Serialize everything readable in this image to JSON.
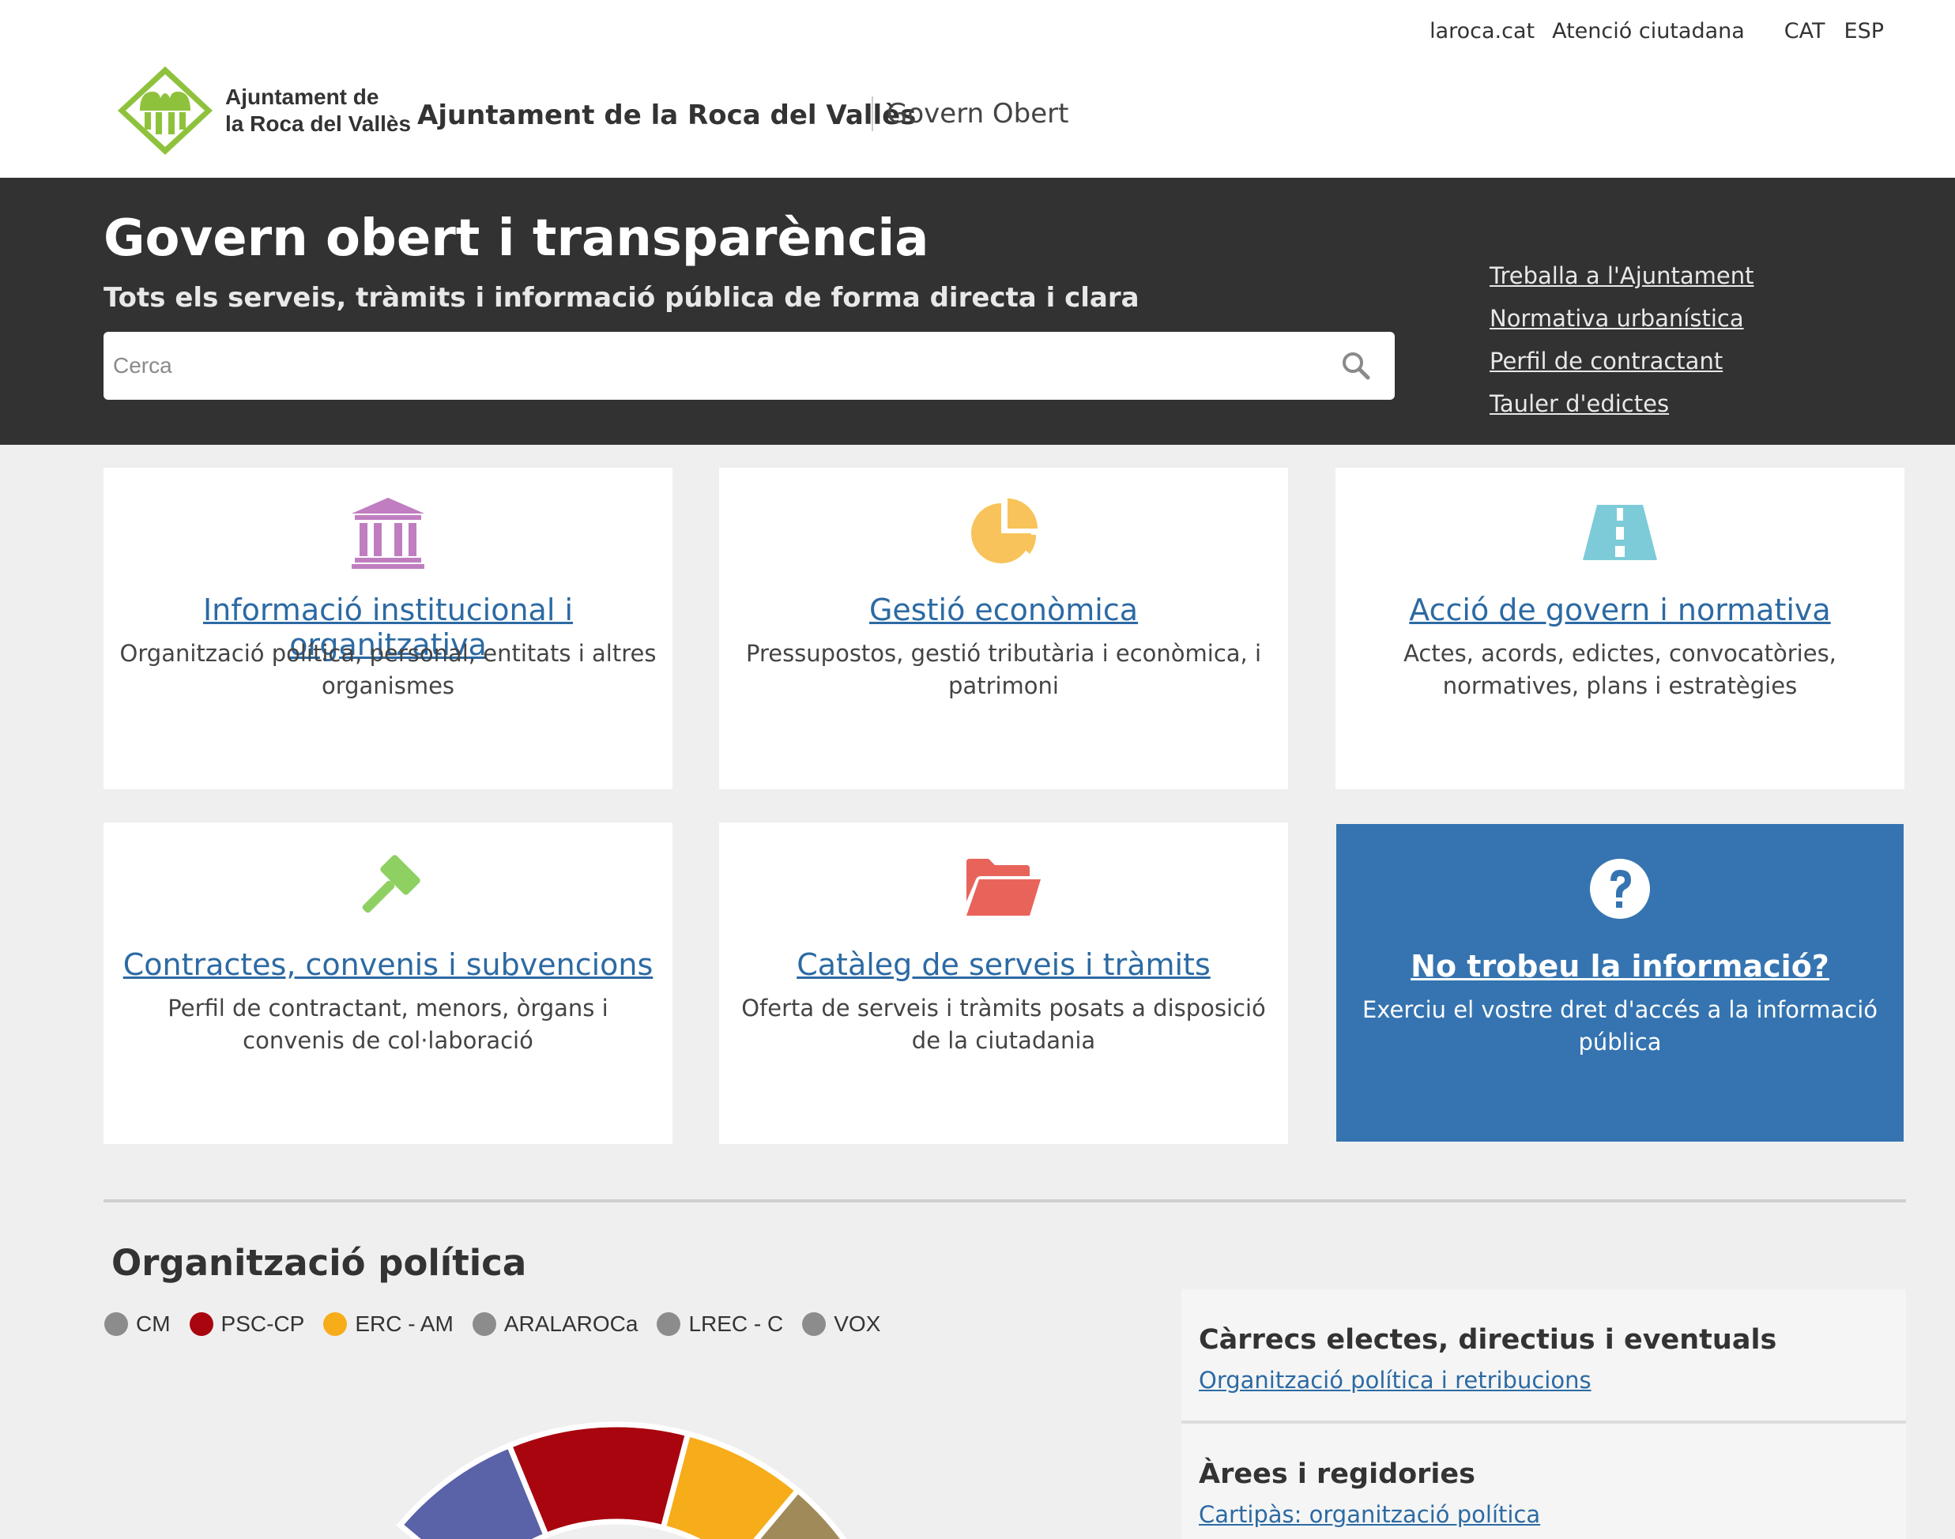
{
  "header": {
    "top_links": [
      "laroca.cat",
      "Atenció ciutadana"
    ],
    "languages": [
      "CAT",
      "ESP"
    ],
    "logo_lines": [
      "Ajuntament de",
      "la Roca del Vallès"
    ],
    "brand_title": "Ajuntament de la Roca del Vallès",
    "brand_sub": "Govern Obert"
  },
  "hero": {
    "title": "Govern obert i transparència",
    "subtitle": "Tots els serveis, tràmits i informació pública de forma directa i clara",
    "search_placeholder": "Cerca",
    "links": [
      "Treballa a l'Ajuntament",
      "Normativa urbanística",
      "Perfil de contractant",
      "Tauler d'edictes"
    ]
  },
  "cards": [
    {
      "title": "Informació institucional i organitzativa",
      "desc": "Organització política, personal, entitats i altres organismes",
      "icon": "institution-icon",
      "color": "#c07ec0"
    },
    {
      "title": "Gestió econòmica",
      "desc": "Pressupostos, gestió tributària i econòmica, i patrimoni",
      "icon": "pie-chart-icon",
      "color": "#f8c35a"
    },
    {
      "title": "Acció de govern i normativa",
      "desc": "Actes, acords, edictes, convocatòries, normatives, plans i estratègies",
      "icon": "road-icon",
      "color": "#7dcbd8"
    },
    {
      "title": "Contractes, convenis i subvencions",
      "desc": "Perfil de contractant, menors, òrgans i convenis de col·laboració",
      "icon": "gavel-icon",
      "color": "#8ed062"
    },
    {
      "title": "Catàleg de serveis i tràmits",
      "desc": "Oferta de serveis i tràmits posats a disposició de la ciutadania",
      "icon": "folder-open-icon",
      "color": "#e8645a"
    },
    {
      "title": "No trobeu la informació?",
      "desc": "Exerciu el vostre dret d'accés a la informació pública",
      "icon": "question-icon",
      "color": "#3574b0"
    }
  ],
  "politics": {
    "title": "Organització política",
    "parties": [
      {
        "name": "CM",
        "color": "#8c8c8c"
      },
      {
        "name": "PSC-CP",
        "color": "#a8050f"
      },
      {
        "name": "ERC - AM",
        "color": "#f7ac1a"
      },
      {
        "name": "ARALAROCa",
        "color": "#8c8c8c"
      },
      {
        "name": "LREC - C",
        "color": "#8c8c8c"
      },
      {
        "name": "VOX",
        "color": "#8c8c8c"
      }
    ],
    "side": [
      {
        "heading": "Càrrecs electes, directius i eventuals",
        "link": "Organització política i retribucions"
      },
      {
        "heading": "Àrees i regidories",
        "link": "Cartipàs: organització política"
      }
    ]
  }
}
